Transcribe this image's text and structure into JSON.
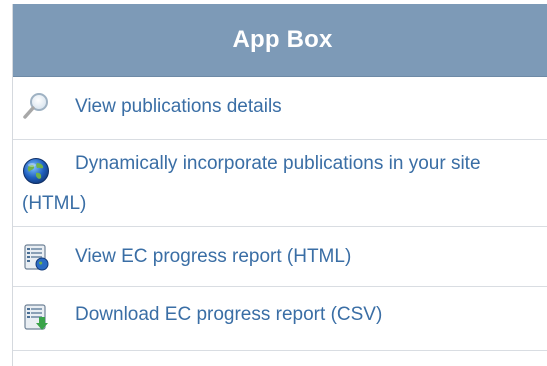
{
  "app_box": {
    "title": "App Box",
    "items": [
      {
        "label": "View publications details",
        "icon": "magnifier-icon"
      },
      {
        "label": "Dynamically incorporate publications in your site (HTML)",
        "icon": "globe-icon"
      },
      {
        "label": "View EC progress report (HTML)",
        "icon": "report-web-icon"
      },
      {
        "label": "Download EC progress report (CSV)",
        "icon": "report-download-icon"
      }
    ]
  },
  "colors": {
    "header_bg": "#7d9ab7",
    "header_text": "#ffffff",
    "link": "#3a6ea5",
    "divider": "#d9dde2"
  }
}
